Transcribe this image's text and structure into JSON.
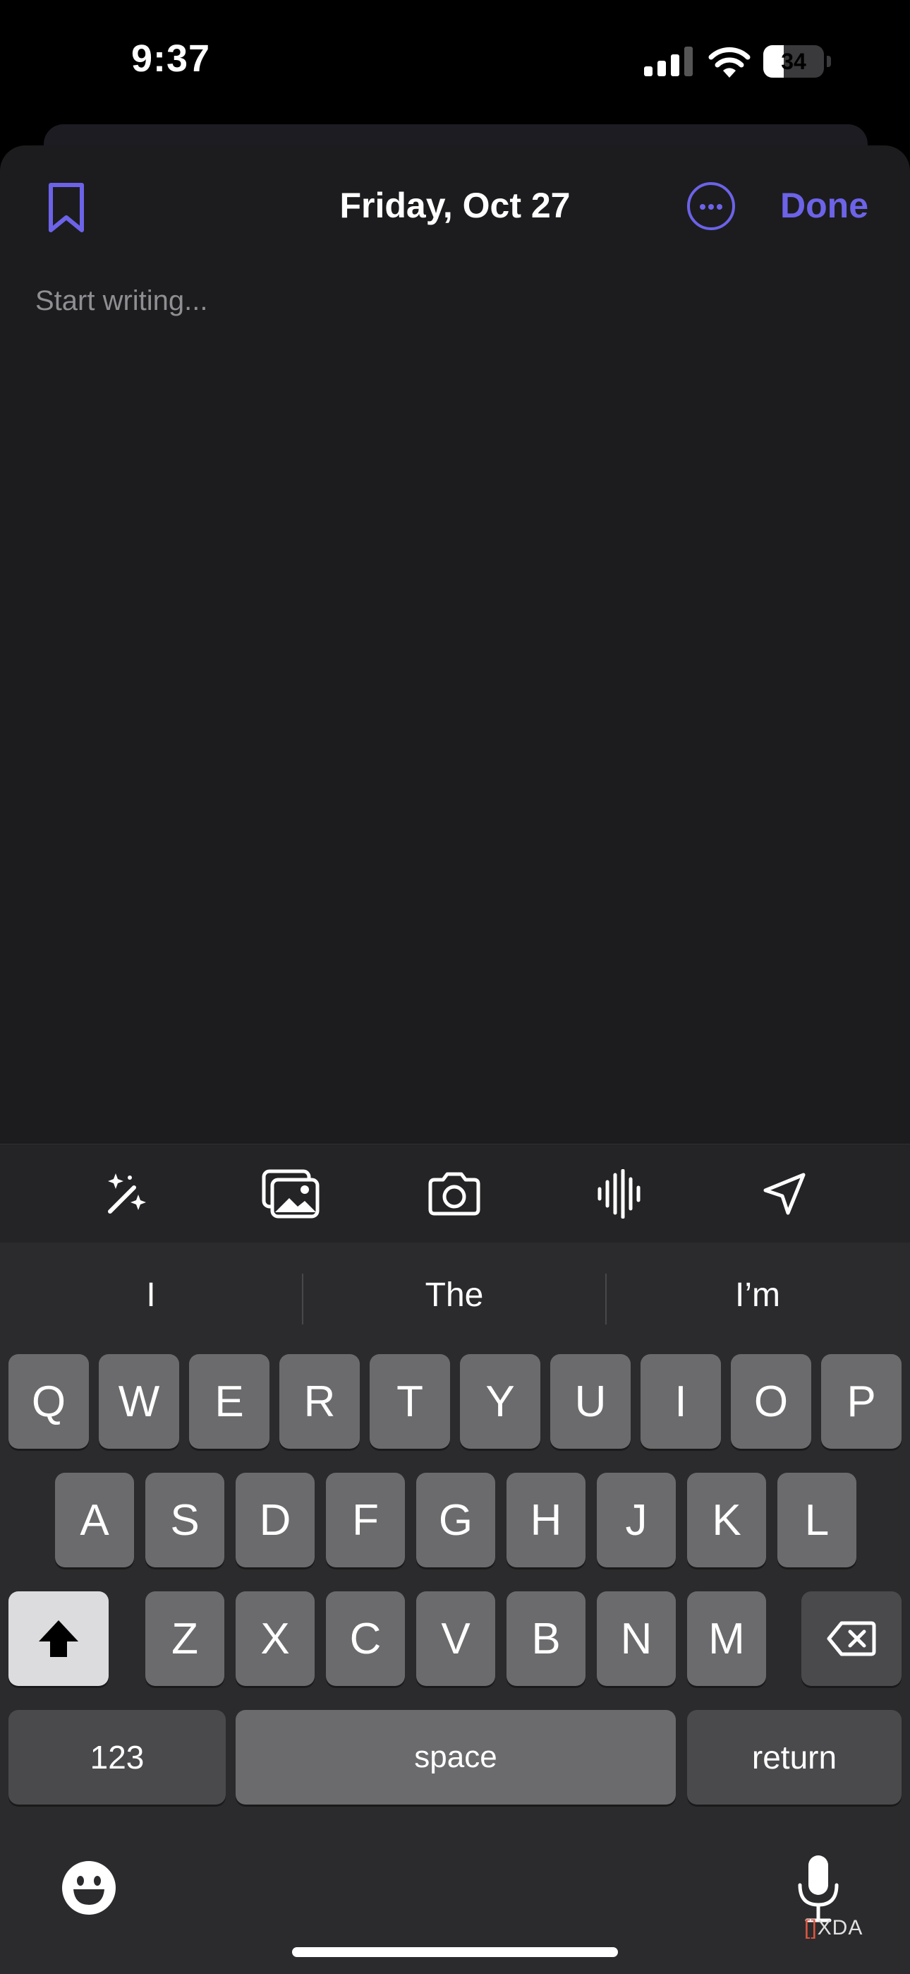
{
  "status_bar": {
    "time": "9:37",
    "battery": "34",
    "battery_level": 0.34
  },
  "header": {
    "title": "Friday, Oct 27",
    "done_label": "Done"
  },
  "editor": {
    "placeholder": "Start writing..."
  },
  "toolbar": {
    "icons": [
      "magic-wand-icon",
      "photo-library-icon",
      "camera-icon",
      "audio-waveform-icon",
      "location-arrow-icon"
    ]
  },
  "keyboard": {
    "suggestions": [
      "I",
      "The",
      "I’m"
    ],
    "row1": [
      "Q",
      "W",
      "E",
      "R",
      "T",
      "Y",
      "U",
      "I",
      "O",
      "P"
    ],
    "row2": [
      "A",
      "S",
      "D",
      "F",
      "G",
      "H",
      "J",
      "K",
      "L"
    ],
    "row3": [
      "Z",
      "X",
      "C",
      "V",
      "B",
      "N",
      "M"
    ],
    "numbers_label": "123",
    "space_label": "space",
    "return_label": "return"
  },
  "watermark": {
    "bracket": "[]",
    "text": "XDA"
  },
  "colors": {
    "accent": "#6c63e8",
    "sheet": "#1c1c1e",
    "keyboard": "#2b2b2d"
  }
}
